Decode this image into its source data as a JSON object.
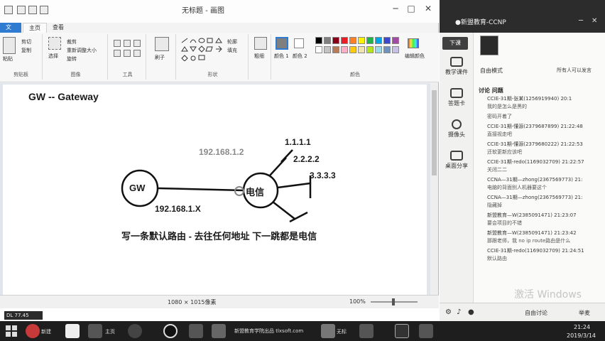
{
  "paint": {
    "title": "无标题 - 画图",
    "file_tab": "文件",
    "tabs": [
      "主页",
      "查看"
    ],
    "ribbon": {
      "clipboard": {
        "paste": "粘贴",
        "cut": "剪切",
        "copy": "复制",
        "label": "剪贴板"
      },
      "image": {
        "select": "选择",
        "crop": "裁剪",
        "resize": "重新调整大小",
        "rotate": "旋转",
        "label": "图像"
      },
      "tools": {
        "label": "工具"
      },
      "brushes": {
        "label": "刷子"
      },
      "shapes": {
        "outline": "轮廓",
        "fill": "填充",
        "label": "形状"
      },
      "size": {
        "label": "粗细"
      },
      "colors": {
        "color1": "颜色 1",
        "color2": "颜色 2",
        "edit": "编辑颜色",
        "label": "颜色"
      }
    },
    "palette": [
      "#000000",
      "#7f7f7f",
      "#880015",
      "#ed1c24",
      "#ff7f27",
      "#fff200",
      "#22b14c",
      "#00a2e8",
      "#3f48cc",
      "#a349a4",
      "#ffffff",
      "#c3c3c3",
      "#b97a57",
      "#ffaec9",
      "#ffc90e",
      "#efe4b0",
      "#b5e61d",
      "#99d9ea",
      "#7092be",
      "#c8bfe7"
    ],
    "canvas": {
      "heading": "GW -- Gateway",
      "gw_node": "GW",
      "telecom_node": "电信",
      "ip_gray": "192.168.1.2",
      "ip_bottom": "192.168.1.X",
      "route1": "1.1.1.1",
      "route2": "2.2.2.2",
      "route3": "3.3.3.3",
      "note": "写一条默认路由 - 去往任何地址 下一跳都是电信"
    },
    "status": {
      "dimensions": "1080 × 1015像素",
      "zoom": "100%"
    }
  },
  "chat": {
    "title": "●新盟教育-CCNP",
    "sidebar": [
      "下课",
      "教学课件",
      "答题卡",
      "摄像头",
      "桌面分享"
    ],
    "mode": "自由模式",
    "mode_right": "所有人可以发言",
    "tabs": "讨论  问题",
    "messages": [
      {
        "head": "CCIE-31期-张某(1256919940) 20:1",
        "body": "我的是怎么是黑的"
      },
      {
        "head": "",
        "body": "密码开着了"
      },
      {
        "head": "CCIE-31期-懂源(2379687899) 21:22:48",
        "body": "直接视走吧"
      },
      {
        "head": "CCIE-31期-懂源(2379680222) 21:22:53",
        "body": "还软更新应该吧"
      },
      {
        "head": "CCIE-31期-redo(1169032709) 21:22:57",
        "body": "关闭二二"
      },
      {
        "head": "CCNA—31期—zhong(2367569773) 21:",
        "body": "电脑的背面别人机器要这个"
      },
      {
        "head": "CCNA—31期—zhong(2367569773) 21:",
        "body": "隐藏掉"
      },
      {
        "head": "新盟教育—W(2385091471) 21:23:07",
        "body": "要会项目的不错"
      },
      {
        "head": "新盟教育—W(2385091471) 21:23:42",
        "body": "那跟老师，我 no ip route路由是什么"
      },
      {
        "head": "CCIE-31期-redo(1169032709) 21:24:51",
        "body": "默认路由"
      }
    ],
    "watermark": "激活 Windows",
    "input_bar": {
      "free": "自由讨论",
      "raise": "举麦"
    }
  },
  "taskbar": {
    "items": [
      "新建",
      "主页",
      "无标"
    ],
    "center_text": "新盟教育学院出品 tlxsoft.com",
    "time": "21:24",
    "date": "2019/3/14",
    "desktop_tag": "DL 77.45"
  }
}
